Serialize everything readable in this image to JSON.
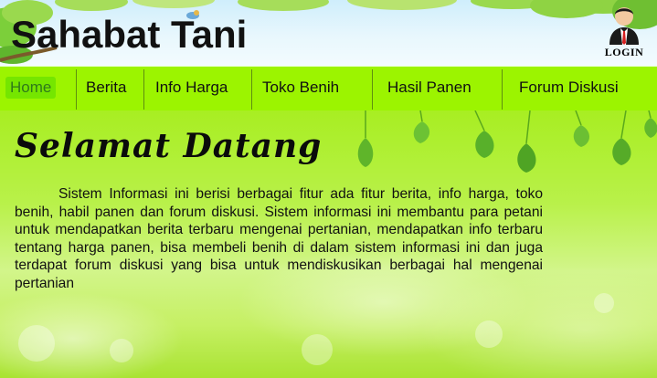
{
  "header": {
    "title": "Sahabat Tani",
    "login_label": "LOGIN"
  },
  "nav": {
    "items": [
      {
        "label": "Home",
        "active": true
      },
      {
        "label": "Berita"
      },
      {
        "label": "Info Harga"
      },
      {
        "label": "Toko Benih"
      },
      {
        "label": "Hasil Panen"
      },
      {
        "label": "Forum Diskusi"
      }
    ]
  },
  "main": {
    "heading": "Selamat Datang",
    "paragraph": "Sistem Informasi ini berisi berbagai fitur ada fitur berita, info harga, toko benih, habil panen dan forum diskusi. Sistem informasi ini membantu para petani untuk mendapatkan berita terbaru mengenai pertanian, mendapatkan info terbaru tentang harga panen, bisa membeli benih di dalam sistem informasi ini dan juga terdapat forum diskusi yang bisa untuk mendiskusikan berbagai hal mengenai pertanian"
  },
  "colors": {
    "nav_bg": "#9cf400",
    "home_bg": "#75e600",
    "home_text": "#2f7a1a"
  }
}
